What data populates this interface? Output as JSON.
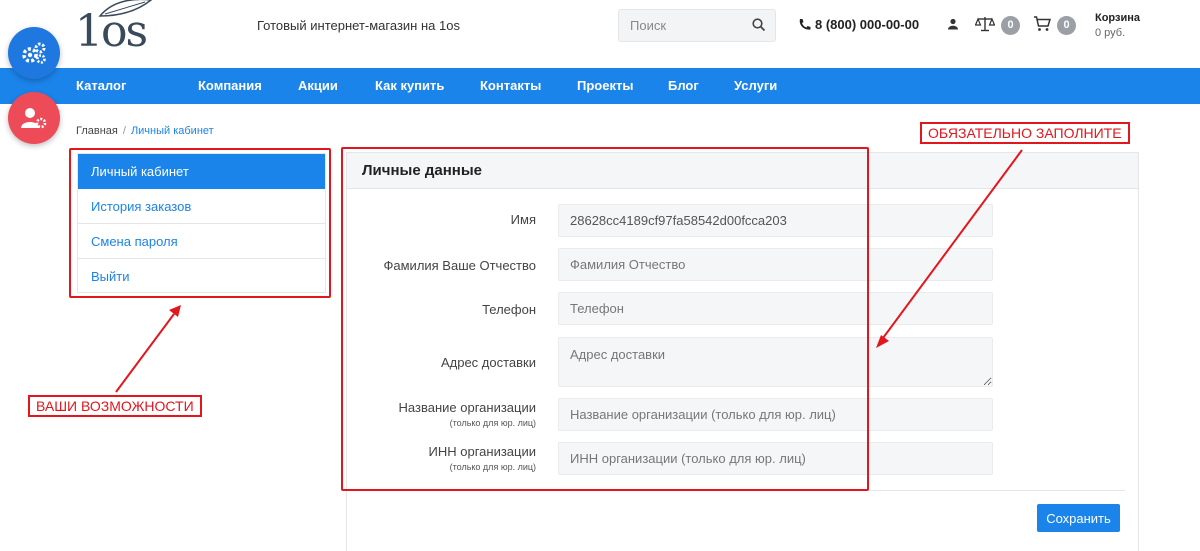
{
  "header": {
    "logo_text": "1os",
    "tagline": "Готовый интернет-магазин на 1os",
    "search": {
      "placeholder": "Поиск"
    },
    "phone": "8 (800) 000-00-00",
    "compare_count": "0",
    "cart_count": "0",
    "cart_title": "Корзина",
    "cart_sum": "0 руб."
  },
  "nav": {
    "items": [
      "Каталог",
      "Компания",
      "Акции",
      "Как купить",
      "Контакты",
      "Проекты",
      "Блог",
      "Услуги"
    ]
  },
  "breadcrumb": {
    "home": "Главная",
    "separator": "/",
    "current": "Личный кабинет"
  },
  "sidebar": {
    "items": [
      {
        "label": "Личный кабинет",
        "active": true
      },
      {
        "label": "История заказов",
        "active": false
      },
      {
        "label": "Смена пароля",
        "active": false
      },
      {
        "label": "Выйти",
        "active": false
      }
    ]
  },
  "form": {
    "title": "Личные данные",
    "fields": [
      {
        "label": "Имя",
        "note": "",
        "value": "28628cc4189cf97fa58542d00fcca203",
        "placeholder": ""
      },
      {
        "label": "Фамилия Ваше Отчество",
        "note": "",
        "value": "",
        "placeholder": "Фамилия Отчество"
      },
      {
        "label": "Телефон",
        "note": "",
        "value": "",
        "placeholder": "Телефон"
      },
      {
        "label": "Адрес доставки",
        "note": "",
        "value": "",
        "placeholder": "Адрес доставки"
      },
      {
        "label": "Название организации",
        "note": "(только для юр. лиц)",
        "value": "",
        "placeholder": "Название организации (только для юр. лиц)"
      },
      {
        "label": "ИНН организации",
        "note": "(только для юр. лиц)",
        "value": "",
        "placeholder": "ИНН организации (только для юр. лиц)"
      }
    ],
    "save_label": "Сохранить"
  },
  "annotations": {
    "left_note": "ВАШИ ВОЗМОЖНОСТИ",
    "right_note": "ОБЯЗАТЕЛЬНО ЗАПОЛНИТЕ",
    "color": "#e3161d"
  },
  "colors": {
    "accent": "#1b84ea",
    "fab_blue": "#1f78e0",
    "fab_red": "#ee4b59"
  }
}
